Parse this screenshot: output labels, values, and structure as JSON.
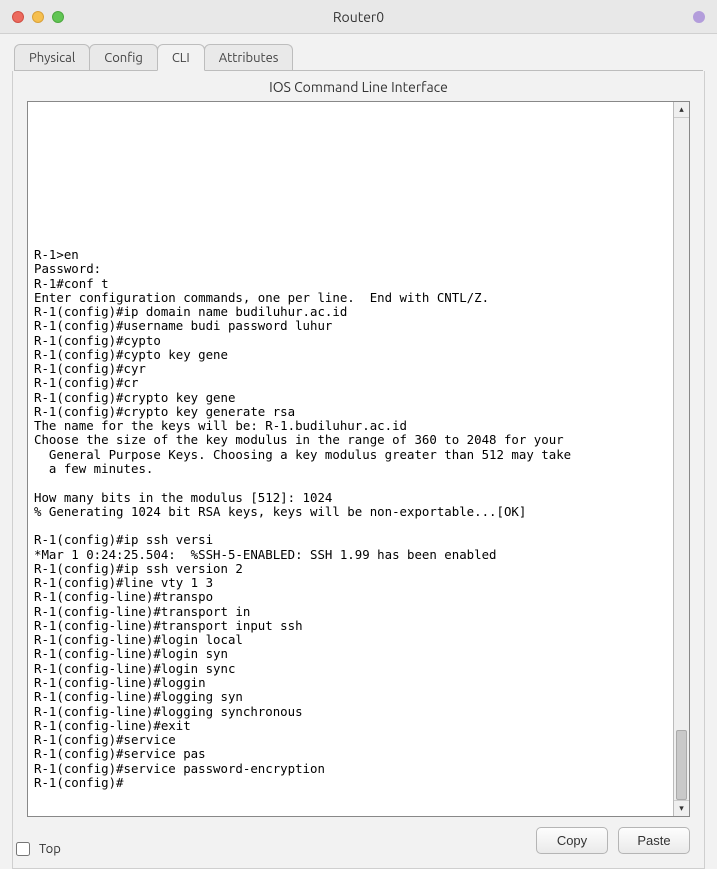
{
  "window": {
    "title": "Router0"
  },
  "tabs": {
    "items": [
      "Physical",
      "Config",
      "CLI",
      "Attributes"
    ],
    "active_index": 2
  },
  "panel": {
    "caption": "IOS Command Line Interface"
  },
  "terminal": {
    "text": "R-1>en\nPassword:\nR-1#conf t\nEnter configuration commands, one per line.  End with CNTL/Z.\nR-1(config)#ip domain name budiluhur.ac.id\nR-1(config)#username budi password luhur\nR-1(config)#cypto\nR-1(config)#cypto key gene\nR-1(config)#cyr\nR-1(config)#cr\nR-1(config)#crypto key gene\nR-1(config)#crypto key generate rsa\nThe name for the keys will be: R-1.budiluhur.ac.id\nChoose the size of the key modulus in the range of 360 to 2048 for your\n  General Purpose Keys. Choosing a key modulus greater than 512 may take\n  a few minutes.\n\nHow many bits in the modulus [512]: 1024\n% Generating 1024 bit RSA keys, keys will be non-exportable...[OK]\n\nR-1(config)#ip ssh versi\n*Mar 1 0:24:25.504:  %SSH-5-ENABLED: SSH 1.99 has been enabled\nR-1(config)#ip ssh version 2\nR-1(config)#line vty 1 3\nR-1(config-line)#transpo\nR-1(config-line)#transport in\nR-1(config-line)#transport input ssh\nR-1(config-line)#login local\nR-1(config-line)#login syn\nR-1(config-line)#login sync\nR-1(config-line)#loggin\nR-1(config-line)#logging syn\nR-1(config-line)#logging synchronous\nR-1(config-line)#exit\nR-1(config)#service\nR-1(config)#service pas\nR-1(config)#service password-encryption\nR-1(config)#"
  },
  "buttons": {
    "copy": "Copy",
    "paste": "Paste"
  },
  "bottom": {
    "top_label": "Top",
    "top_checked": false
  }
}
